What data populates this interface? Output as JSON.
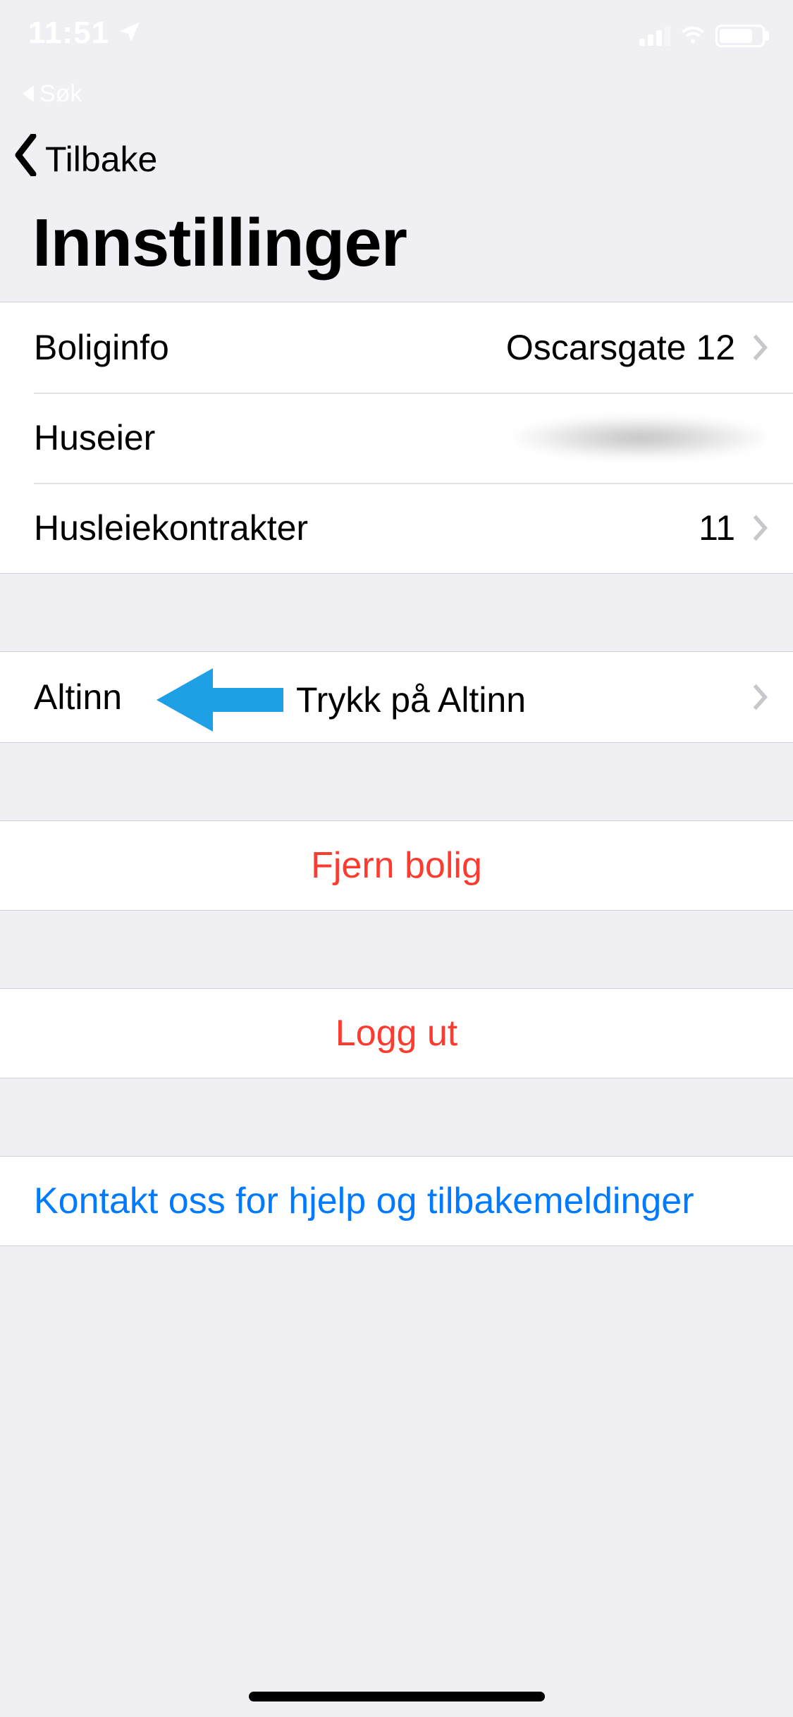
{
  "status_bar": {
    "time": "11:51",
    "breadcrumb_app": "Søk"
  },
  "nav": {
    "back_label": "Tilbake"
  },
  "page": {
    "title": "Innstillinger"
  },
  "group1": {
    "boliginfo_label": "Boliginfo",
    "boliginfo_value": "Oscarsgate 12",
    "huseier_label": "Huseier",
    "husleie_label": "Husleiekontrakter",
    "husleie_value": "11"
  },
  "group2": {
    "altinn_label": "Altinn"
  },
  "annotation": {
    "text": "Trykk på Altinn"
  },
  "actions": {
    "remove_label": "Fjern bolig",
    "logout_label": "Logg ut",
    "contact_label": "Kontakt oss for hjelp og tilbakemeldinger"
  }
}
